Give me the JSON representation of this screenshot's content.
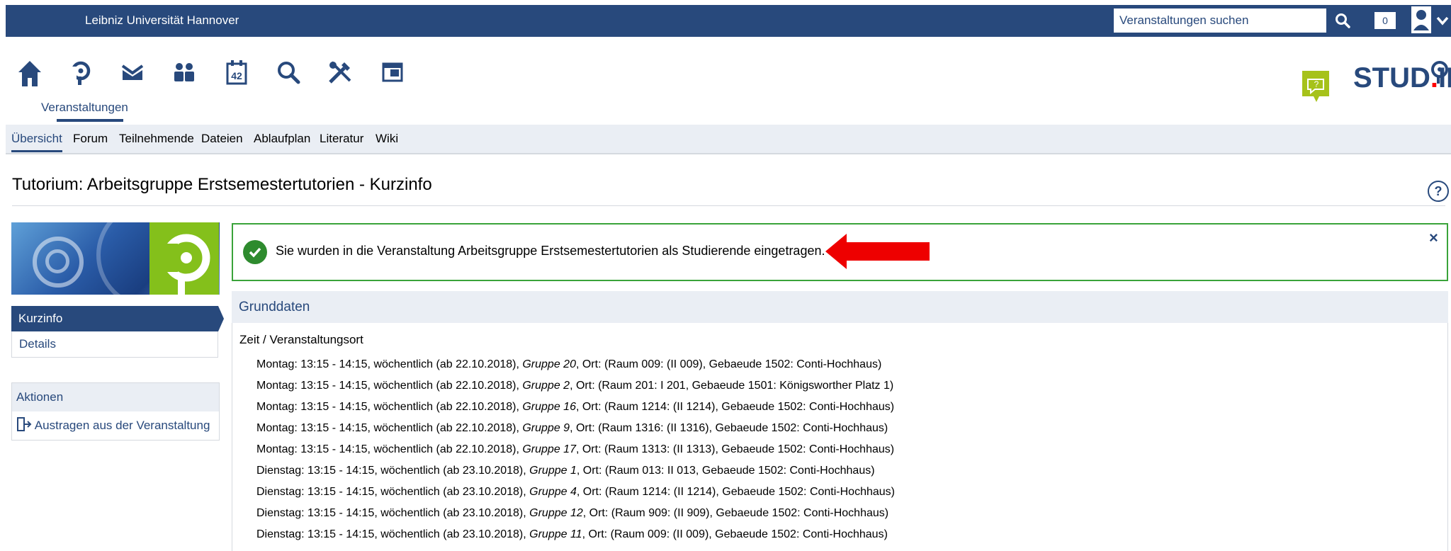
{
  "topbar": {
    "university": "Leibniz Universität Hannover",
    "search_placeholder": "Veranstaltungen suchen",
    "notification_count": "0"
  },
  "nav": {
    "active_label": "Veranstaltungen",
    "icons": [
      "home-icon",
      "courses-icon",
      "mail-icon",
      "community-icon",
      "calendar-icon",
      "search-icon",
      "tools-icon",
      "admin-icon"
    ]
  },
  "brand": {
    "name_left": "STUD",
    "dot": ".",
    "name_right": "IP"
  },
  "subnav": {
    "tabs": [
      "Übersicht",
      "Forum",
      "Teilnehmende",
      "Dateien",
      "Ablaufplan",
      "Literatur",
      "Wiki"
    ]
  },
  "page": {
    "title": "Tutorium: Arbeitsgruppe Erstsemestertutorien - Kurzinfo",
    "help": "?"
  },
  "sidebar": {
    "nav_items": [
      "Kurzinfo",
      "Details"
    ],
    "actions_title": "Aktionen",
    "action_item": "Austragen aus der Veranstaltung"
  },
  "message": {
    "text": "Sie wurden in die Veranstaltung Arbeitsgruppe Erstsemestertutorien als Studierende eingetragen.",
    "close": "×"
  },
  "grunddaten": {
    "heading": "Grunddaten",
    "zeit_label": "Zeit / Veranstaltungsort",
    "lines": [
      {
        "pre": "Montag: 13:15 - 14:15, wöchentlich (ab 22.10.2018), ",
        "group": "Gruppe 20",
        "post": ", Ort: (Raum 009: (II 009), Gebaeude 1502: Conti-Hochhaus)"
      },
      {
        "pre": "Montag: 13:15 - 14:15, wöchentlich (ab 22.10.2018), ",
        "group": "Gruppe 2",
        "post": ", Ort: (Raum 201: I 201, Gebaeude 1501: Königsworther Platz 1)"
      },
      {
        "pre": "Montag: 13:15 - 14:15, wöchentlich (ab 22.10.2018), ",
        "group": "Gruppe 16",
        "post": ", Ort: (Raum 1214: (II 1214), Gebaeude 1502: Conti-Hochhaus)"
      },
      {
        "pre": "Montag: 13:15 - 14:15, wöchentlich (ab 22.10.2018), ",
        "group": "Gruppe 9",
        "post": ", Ort: (Raum 1316: (II 1316), Gebaeude 1502: Conti-Hochhaus)"
      },
      {
        "pre": "Montag: 13:15 - 14:15, wöchentlich (ab 22.10.2018), ",
        "group": "Gruppe 17",
        "post": ", Ort: (Raum 1313: (II 1313), Gebaeude 1502: Conti-Hochhaus)"
      },
      {
        "pre": "Dienstag: 13:15 - 14:15, wöchentlich (ab 23.10.2018), ",
        "group": "Gruppe 1",
        "post": ", Ort: (Raum 013: II 013, Gebaeude 1502: Conti-Hochhaus)"
      },
      {
        "pre": "Dienstag: 13:15 - 14:15, wöchentlich (ab 23.10.2018), ",
        "group": "Gruppe 4",
        "post": ", Ort: (Raum 1214: (II 1214), Gebaeude 1502: Conti-Hochhaus)"
      },
      {
        "pre": "Dienstag: 13:15 - 14:15, wöchentlich (ab 23.10.2018), ",
        "group": "Gruppe 12",
        "post": ", Ort: (Raum 909: (II 909), Gebaeude 1502: Conti-Hochhaus)"
      },
      {
        "pre": "Dienstag: 13:15 - 14:15, wöchentlich (ab 23.10.2018), ",
        "group": "Gruppe 11",
        "post": ", Ort: (Raum 009: (II 009), Gebaeude 1502: Conti-Hochhaus)"
      }
    ]
  },
  "colors": {
    "brand_blue": "#28497c",
    "success_green": "#3aa33a",
    "arrow_red": "#ee0000",
    "logo_green": "#84c01b"
  }
}
